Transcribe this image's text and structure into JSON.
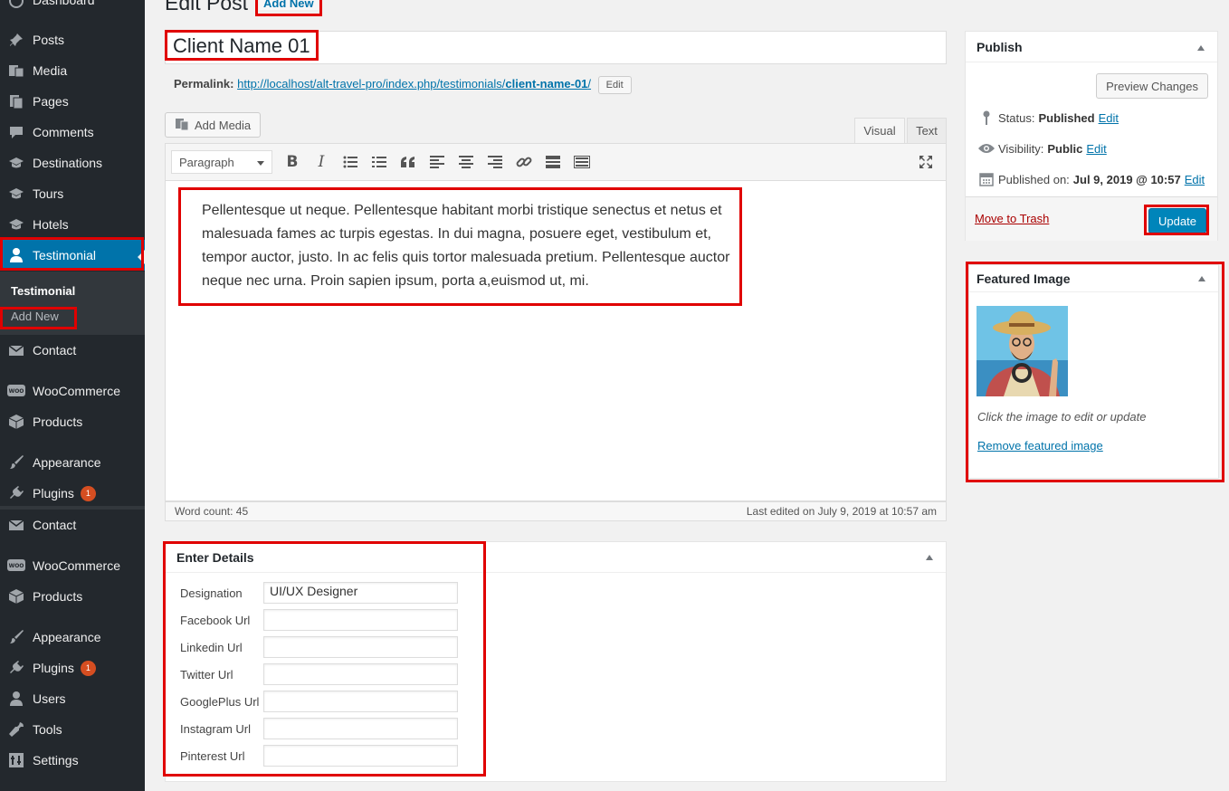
{
  "sidebar": {
    "items": [
      {
        "label": "Dashboard",
        "icon": "dashboard-icon"
      },
      {
        "label": "Posts",
        "icon": "pin-icon"
      },
      {
        "label": "Media",
        "icon": "media-icon"
      },
      {
        "label": "Pages",
        "icon": "pages-icon"
      },
      {
        "label": "Comments",
        "icon": "comment-icon"
      },
      {
        "label": "Destinations",
        "icon": "mortarboard-icon"
      },
      {
        "label": "Tours",
        "icon": "mortarboard-icon"
      },
      {
        "label": "Hotels",
        "icon": "mortarboard-icon"
      },
      {
        "label": "Testimonial",
        "icon": "user-icon"
      },
      {
        "label": "Contact",
        "icon": "envelope-icon"
      },
      {
        "label": "WooCommerce",
        "icon": "woo-icon"
      },
      {
        "label": "Products",
        "icon": "box-icon"
      },
      {
        "label": "Appearance",
        "icon": "brush-icon"
      },
      {
        "label": "Plugins",
        "icon": "plug-icon",
        "badge": "1"
      },
      {
        "label": "Contact",
        "icon": "envelope-icon"
      },
      {
        "label": "WooCommerce",
        "icon": "woo-icon"
      },
      {
        "label": "Products",
        "icon": "box-icon"
      },
      {
        "label": "Appearance",
        "icon": "brush-icon"
      },
      {
        "label": "Plugins",
        "icon": "plug-icon",
        "badge": "1"
      },
      {
        "label": "Users",
        "icon": "user-icon"
      },
      {
        "label": "Tools",
        "icon": "wrench-icon"
      },
      {
        "label": "Settings",
        "icon": "settings-icon"
      }
    ],
    "submenu": {
      "title": "Testimonial",
      "add_new": "Add New"
    }
  },
  "header": {
    "title": "Edit Post",
    "add_new": "Add New"
  },
  "post": {
    "title": "Client Name 01",
    "permalink_label": "Permalink:",
    "permalink_base": "http://localhost/alt-travel-pro/index.php/testimonials/",
    "permalink_slug": "client-name-01",
    "permalink_end": "/",
    "permalink_edit": "Edit"
  },
  "editor": {
    "add_media": "Add Media",
    "tab_visual": "Visual",
    "tab_text": "Text",
    "format": "Paragraph",
    "content": "Pellentesque ut neque. Pellentesque habitant morbi tristique senectus et netus et malesuada fames ac turpis egestas. In dui magna, posuere eget, vestibulum et, tempor auctor, justo. In ac felis quis tortor malesuada pretium. Pellentesque auctor neque nec urna. Proin sapien ipsum, porta a,euismod ut, mi.",
    "word_count": "Word count: 45",
    "last_edited": "Last edited on July 9, 2019 at 10:57 am"
  },
  "details": {
    "title": "Enter Details",
    "fields": [
      {
        "label": "Designation",
        "value": "UI/UX Designer"
      },
      {
        "label": "Facebook Url",
        "value": ""
      },
      {
        "label": "Linkedin Url",
        "value": ""
      },
      {
        "label": "Twitter Url",
        "value": ""
      },
      {
        "label": "GooglePlus Url",
        "value": ""
      },
      {
        "label": "Instagram Url",
        "value": ""
      },
      {
        "label": "Pinterest Url",
        "value": ""
      }
    ]
  },
  "publish": {
    "title": "Publish",
    "preview": "Preview Changes",
    "status_label": "Status:",
    "status_value": "Published",
    "visibility_label": "Visibility:",
    "visibility_value": "Public",
    "published_label": "Published on:",
    "published_value": "Jul 9, 2019 @ 10:57",
    "edit": "Edit",
    "trash": "Move to Trash",
    "update": "Update"
  },
  "featured": {
    "title": "Featured Image",
    "hint": "Click the image to edit or update",
    "remove": "Remove featured image"
  },
  "colors": {
    "accent": "#0073aa",
    "highlight": "#e00000",
    "sidebar": "#23282d"
  }
}
